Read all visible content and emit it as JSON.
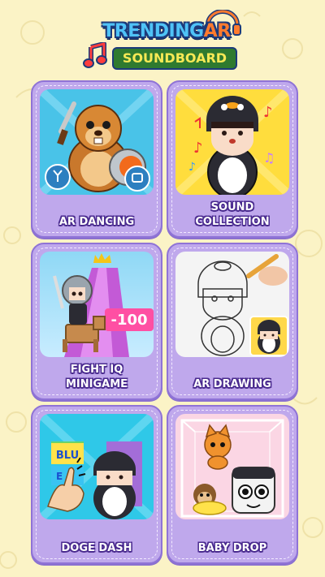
{
  "header": {
    "logo_line1_a": "TRENDING",
    "logo_line1_b": "AR",
    "logo_line2": "SOUNDBOARD"
  },
  "menu": [
    {
      "label": "AR DANCING",
      "icon": "beaver-dancer-icon"
    },
    {
      "label": "SOUND\nCOLLECTION",
      "icon": "penguin-girl-singing-icon"
    },
    {
      "label": "FIGHT IQ\nMINIGAME",
      "icon": "knight-girl-runner-icon"
    },
    {
      "label": "AR DRAWING",
      "icon": "penguin-girl-drawing-icon"
    },
    {
      "label": "DOGE DASH",
      "icon": "penguin-girl-tapping-icon"
    },
    {
      "label": "BABY DROP",
      "icon": "cat-monkey-box-icon"
    }
  ],
  "thumb_text": {
    "fight_gate": "-100",
    "doge_tile1": "BLU",
    "doge_tile2": "E"
  },
  "colors": {
    "background": "#fbf3c6",
    "card_fill": "#bfa8ec",
    "card_border": "#8f73d6",
    "label_outline": "#4a2b8f",
    "logo_blue": "#4fc3f7",
    "logo_orange": "#ff7b2e",
    "logo_green": "#2f7a2f"
  }
}
